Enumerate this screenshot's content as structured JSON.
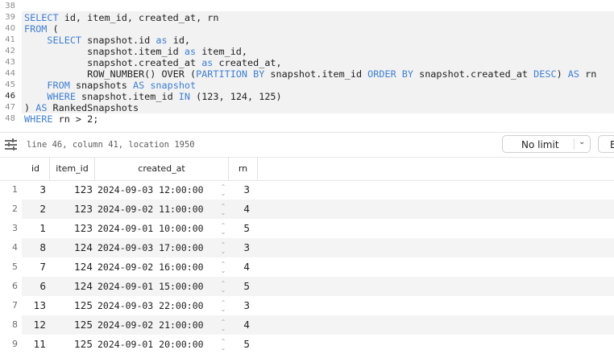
{
  "editor": {
    "lines": [
      {
        "num": "38",
        "tokens": []
      },
      {
        "num": "39",
        "tokens": [
          {
            "t": "SELECT",
            "c": "kw"
          },
          {
            "t": " id, item_id, created_at, rn",
            "c": ""
          }
        ]
      },
      {
        "num": "40",
        "tokens": [
          {
            "t": "FROM",
            "c": "kw"
          },
          {
            "t": " (",
            "c": ""
          }
        ]
      },
      {
        "num": "41",
        "tokens": [
          {
            "t": "    ",
            "c": ""
          },
          {
            "t": "SELECT",
            "c": "kw"
          },
          {
            "t": " snapshot.id ",
            "c": ""
          },
          {
            "t": "as",
            "c": "kw"
          },
          {
            "t": " id,",
            "c": ""
          }
        ]
      },
      {
        "num": "42",
        "tokens": [
          {
            "t": "           snapshot.item_id ",
            "c": ""
          },
          {
            "t": "as",
            "c": "kw"
          },
          {
            "t": " item_id,",
            "c": ""
          }
        ]
      },
      {
        "num": "43",
        "tokens": [
          {
            "t": "           snapshot.created_at ",
            "c": ""
          },
          {
            "t": "as",
            "c": "kw"
          },
          {
            "t": " created_at,",
            "c": ""
          }
        ]
      },
      {
        "num": "44",
        "tokens": [
          {
            "t": "           ROW_NUMBER() OVER (",
            "c": ""
          },
          {
            "t": "PARTITION BY",
            "c": "kw"
          },
          {
            "t": " snapshot.item_id ",
            "c": ""
          },
          {
            "t": "ORDER BY",
            "c": "kw"
          },
          {
            "t": " snapshot.created_at ",
            "c": ""
          },
          {
            "t": "DESC",
            "c": "kw"
          },
          {
            "t": ") ",
            "c": ""
          },
          {
            "t": "AS",
            "c": "kw"
          },
          {
            "t": " rn",
            "c": ""
          }
        ]
      },
      {
        "num": "45",
        "tokens": [
          {
            "t": "    ",
            "c": ""
          },
          {
            "t": "FROM",
            "c": "kw"
          },
          {
            "t": " snapshots ",
            "c": ""
          },
          {
            "t": "AS",
            "c": "kw"
          },
          {
            "t": " ",
            "c": ""
          },
          {
            "t": "snapshot",
            "c": "tbl"
          }
        ]
      },
      {
        "num": "46",
        "active": true,
        "tokens": [
          {
            "t": "    ",
            "c": ""
          },
          {
            "t": "WHERE",
            "c": "kw"
          },
          {
            "t": " snapshot.item_id ",
            "c": ""
          },
          {
            "t": "IN",
            "c": "kw"
          },
          {
            "t": " (123, 124, 125)",
            "c": ""
          }
        ]
      },
      {
        "num": "47",
        "tokens": [
          {
            "t": ") ",
            "c": ""
          },
          {
            "t": "AS",
            "c": "kw"
          },
          {
            "t": " RankedSnapshots",
            "c": ""
          }
        ]
      },
      {
        "num": "48",
        "tokens": [
          {
            "t": "WHERE",
            "c": "kw"
          },
          {
            "t": " rn > 2;",
            "c": ""
          }
        ]
      }
    ]
  },
  "status": {
    "position_text": "line 46, column 41, location 1950",
    "limit_value": "No limit",
    "cut_button_label": "E"
  },
  "results": {
    "columns": [
      "id",
      "item_id",
      "created_at",
      "rn"
    ],
    "rows": [
      {
        "n": "1",
        "id": "3",
        "item_id": "123",
        "created_at": "2024-09-03 12:00:00",
        "rn": "3"
      },
      {
        "n": "2",
        "id": "2",
        "item_id": "123",
        "created_at": "2024-09-02 11:00:00",
        "rn": "4"
      },
      {
        "n": "3",
        "id": "1",
        "item_id": "123",
        "created_at": "2024-09-01 10:00:00",
        "rn": "5"
      },
      {
        "n": "4",
        "id": "8",
        "item_id": "124",
        "created_at": "2024-09-03 17:00:00",
        "rn": "3"
      },
      {
        "n": "5",
        "id": "7",
        "item_id": "124",
        "created_at": "2024-09-02 16:00:00",
        "rn": "4"
      },
      {
        "n": "6",
        "id": "6",
        "item_id": "124",
        "created_at": "2024-09-01 15:00:00",
        "rn": "5"
      },
      {
        "n": "7",
        "id": "13",
        "item_id": "125",
        "created_at": "2024-09-03 22:00:00",
        "rn": "3"
      },
      {
        "n": "8",
        "id": "12",
        "item_id": "125",
        "created_at": "2024-09-02 21:00:00",
        "rn": "4"
      },
      {
        "n": "9",
        "id": "11",
        "item_id": "125",
        "created_at": "2024-09-01 20:00:00",
        "rn": "5"
      }
    ]
  }
}
